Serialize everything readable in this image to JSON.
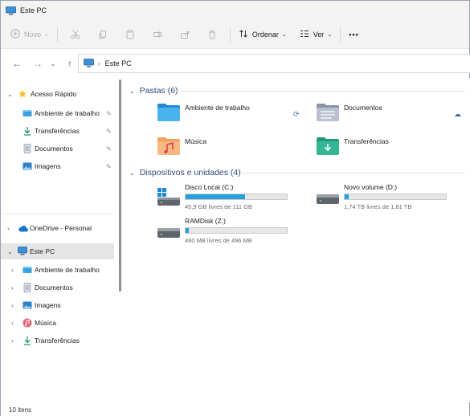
{
  "window": {
    "title": "Este PC"
  },
  "toolbar": {
    "new_label": "Novo",
    "sort_label": "Ordenar",
    "view_label": "Ver",
    "more_label": "•••"
  },
  "address": {
    "location": "Este PC"
  },
  "sidebar": {
    "quick_access": {
      "label": "Acesso Rápido",
      "items": [
        {
          "label": "Ambiente de trabalho",
          "icon": "desktop-folder-icon",
          "pinned": true
        },
        {
          "label": "Transferências",
          "icon": "downloads-icon",
          "pinned": true
        },
        {
          "label": "Documentos",
          "icon": "documents-icon",
          "pinned": true
        },
        {
          "label": "Imagens",
          "icon": "pictures-icon",
          "pinned": true
        }
      ]
    },
    "onedrive": {
      "label": "OneDrive - Personal"
    },
    "this_pc": {
      "label": "Este PC",
      "items": [
        {
          "label": "Ambiente de trabalho",
          "icon": "desktop-folder-icon"
        },
        {
          "label": "Documentos",
          "icon": "documents-icon"
        },
        {
          "label": "Imagens",
          "icon": "pictures-icon"
        },
        {
          "label": "Música",
          "icon": "music-icon"
        },
        {
          "label": "Transferências",
          "icon": "downloads-icon"
        }
      ]
    }
  },
  "main": {
    "folders_header": "Pastas (6)",
    "folders": [
      {
        "label": "Ambiente de trabalho",
        "icon": "desktop-folder-icon",
        "status": "sync-icon"
      },
      {
        "label": "Documentos",
        "icon": "documents-folder-icon",
        "status": "cloud-icon"
      },
      {
        "label": "Música",
        "icon": "music-folder-icon"
      },
      {
        "label": "Transferências",
        "icon": "downloads-folder-icon"
      }
    ],
    "devices_header": "Dispositivos e unidades (4)",
    "drives": [
      {
        "label": "Disco Local (C:)",
        "free_text": "45,9 GB livres de 111 GB",
        "used_fraction": 0.59,
        "icon": "windows-drive-icon"
      },
      {
        "label": "Novo volume (D:)",
        "free_text": "1,74 TB livres de 1,81 TB",
        "used_fraction": 0.04,
        "icon": "drive-icon"
      },
      {
        "label": "RAMDisk (Z:)",
        "free_text": "480 MB livres de 496 MB",
        "used_fraction": 0.03,
        "icon": "drive-icon"
      }
    ]
  },
  "status": {
    "item_count": "10 itens"
  },
  "colors": {
    "accent": "#26a0da",
    "header": "#2f4a7f",
    "selected": "#e5e5e5"
  }
}
